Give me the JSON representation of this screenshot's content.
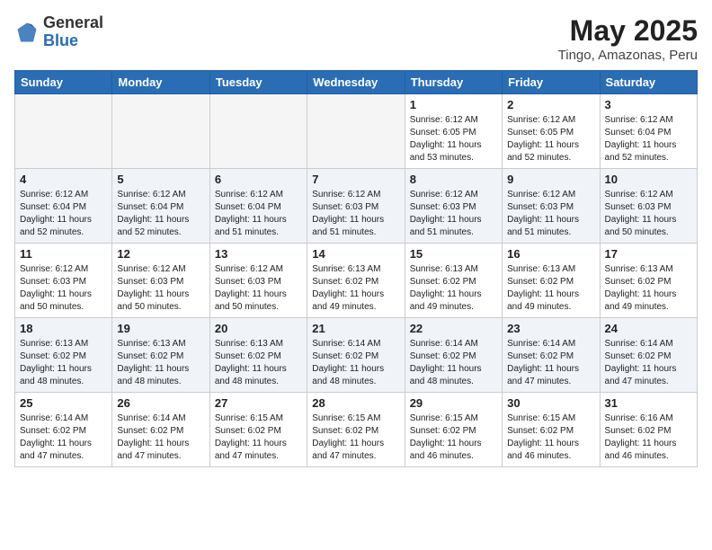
{
  "header": {
    "logo_general": "General",
    "logo_blue": "Blue",
    "title": "May 2025",
    "subtitle": "Tingo, Amazonas, Peru"
  },
  "days_of_week": [
    "Sunday",
    "Monday",
    "Tuesday",
    "Wednesday",
    "Thursday",
    "Friday",
    "Saturday"
  ],
  "weeks": [
    [
      {
        "day": "",
        "empty": true
      },
      {
        "day": "",
        "empty": true
      },
      {
        "day": "",
        "empty": true
      },
      {
        "day": "",
        "empty": true
      },
      {
        "day": "1",
        "sunrise": "6:12 AM",
        "sunset": "6:05 PM",
        "daylight": "11 hours and 53 minutes."
      },
      {
        "day": "2",
        "sunrise": "6:12 AM",
        "sunset": "6:05 PM",
        "daylight": "11 hours and 52 minutes."
      },
      {
        "day": "3",
        "sunrise": "6:12 AM",
        "sunset": "6:04 PM",
        "daylight": "11 hours and 52 minutes."
      }
    ],
    [
      {
        "day": "4",
        "sunrise": "6:12 AM",
        "sunset": "6:04 PM",
        "daylight": "11 hours and 52 minutes."
      },
      {
        "day": "5",
        "sunrise": "6:12 AM",
        "sunset": "6:04 PM",
        "daylight": "11 hours and 52 minutes."
      },
      {
        "day": "6",
        "sunrise": "6:12 AM",
        "sunset": "6:04 PM",
        "daylight": "11 hours and 51 minutes."
      },
      {
        "day": "7",
        "sunrise": "6:12 AM",
        "sunset": "6:03 PM",
        "daylight": "11 hours and 51 minutes."
      },
      {
        "day": "8",
        "sunrise": "6:12 AM",
        "sunset": "6:03 PM",
        "daylight": "11 hours and 51 minutes."
      },
      {
        "day": "9",
        "sunrise": "6:12 AM",
        "sunset": "6:03 PM",
        "daylight": "11 hours and 51 minutes."
      },
      {
        "day": "10",
        "sunrise": "6:12 AM",
        "sunset": "6:03 PM",
        "daylight": "11 hours and 50 minutes."
      }
    ],
    [
      {
        "day": "11",
        "sunrise": "6:12 AM",
        "sunset": "6:03 PM",
        "daylight": "11 hours and 50 minutes."
      },
      {
        "day": "12",
        "sunrise": "6:12 AM",
        "sunset": "6:03 PM",
        "daylight": "11 hours and 50 minutes."
      },
      {
        "day": "13",
        "sunrise": "6:12 AM",
        "sunset": "6:03 PM",
        "daylight": "11 hours and 50 minutes."
      },
      {
        "day": "14",
        "sunrise": "6:13 AM",
        "sunset": "6:02 PM",
        "daylight": "11 hours and 49 minutes."
      },
      {
        "day": "15",
        "sunrise": "6:13 AM",
        "sunset": "6:02 PM",
        "daylight": "11 hours and 49 minutes."
      },
      {
        "day": "16",
        "sunrise": "6:13 AM",
        "sunset": "6:02 PM",
        "daylight": "11 hours and 49 minutes."
      },
      {
        "day": "17",
        "sunrise": "6:13 AM",
        "sunset": "6:02 PM",
        "daylight": "11 hours and 49 minutes."
      }
    ],
    [
      {
        "day": "18",
        "sunrise": "6:13 AM",
        "sunset": "6:02 PM",
        "daylight": "11 hours and 48 minutes."
      },
      {
        "day": "19",
        "sunrise": "6:13 AM",
        "sunset": "6:02 PM",
        "daylight": "11 hours and 48 minutes."
      },
      {
        "day": "20",
        "sunrise": "6:13 AM",
        "sunset": "6:02 PM",
        "daylight": "11 hours and 48 minutes."
      },
      {
        "day": "21",
        "sunrise": "6:14 AM",
        "sunset": "6:02 PM",
        "daylight": "11 hours and 48 minutes."
      },
      {
        "day": "22",
        "sunrise": "6:14 AM",
        "sunset": "6:02 PM",
        "daylight": "11 hours and 48 minutes."
      },
      {
        "day": "23",
        "sunrise": "6:14 AM",
        "sunset": "6:02 PM",
        "daylight": "11 hours and 47 minutes."
      },
      {
        "day": "24",
        "sunrise": "6:14 AM",
        "sunset": "6:02 PM",
        "daylight": "11 hours and 47 minutes."
      }
    ],
    [
      {
        "day": "25",
        "sunrise": "6:14 AM",
        "sunset": "6:02 PM",
        "daylight": "11 hours and 47 minutes."
      },
      {
        "day": "26",
        "sunrise": "6:14 AM",
        "sunset": "6:02 PM",
        "daylight": "11 hours and 47 minutes."
      },
      {
        "day": "27",
        "sunrise": "6:15 AM",
        "sunset": "6:02 PM",
        "daylight": "11 hours and 47 minutes."
      },
      {
        "day": "28",
        "sunrise": "6:15 AM",
        "sunset": "6:02 PM",
        "daylight": "11 hours and 47 minutes."
      },
      {
        "day": "29",
        "sunrise": "6:15 AM",
        "sunset": "6:02 PM",
        "daylight": "11 hours and 46 minutes."
      },
      {
        "day": "30",
        "sunrise": "6:15 AM",
        "sunset": "6:02 PM",
        "daylight": "11 hours and 46 minutes."
      },
      {
        "day": "31",
        "sunrise": "6:16 AM",
        "sunset": "6:02 PM",
        "daylight": "11 hours and 46 minutes."
      }
    ]
  ]
}
